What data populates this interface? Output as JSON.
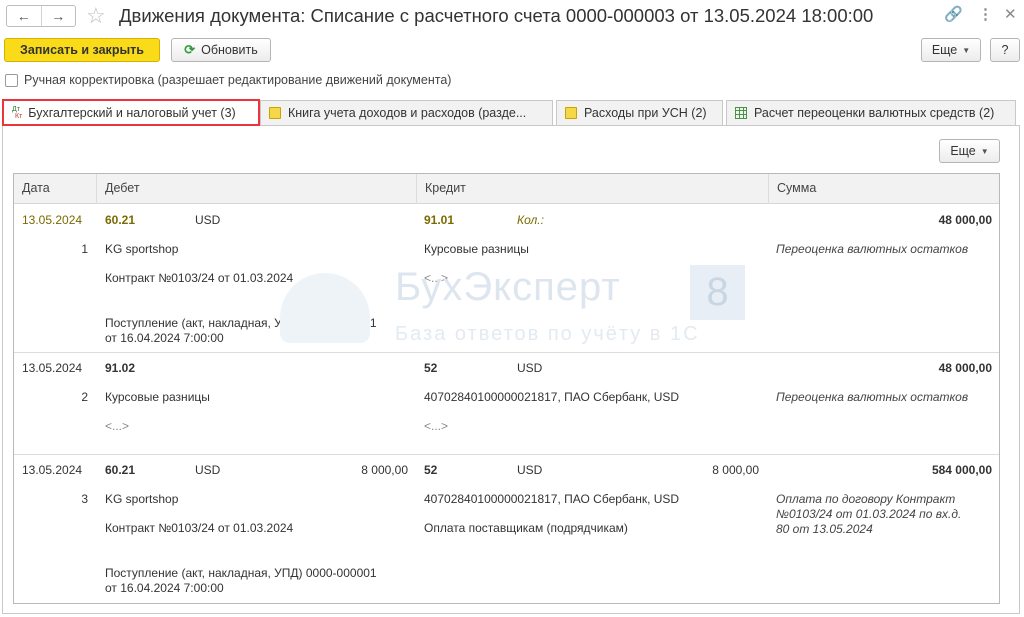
{
  "window": {
    "title": "Движения документа: Списание с расчетного счета 0000-000003 от 13.05.2024 18:00:00"
  },
  "icons": {
    "back": "arrow-left-icon",
    "forward": "arrow-right-icon",
    "star": "star-icon",
    "link": "link-icon",
    "more": "more-vertical-icon",
    "close": "close-icon",
    "refresh": "refresh-icon"
  },
  "toolbar": {
    "save_close": "Записать и закрыть",
    "refresh": "Обновить",
    "more": "Еще",
    "help": "?"
  },
  "manual_edit": {
    "label": "Ручная корректировка (разрешает редактирование движений документа)"
  },
  "tabs": [
    {
      "label": "Бухгалтерский и налоговый учет (3)"
    },
    {
      "label": "Книга учета доходов и расходов (разде..."
    },
    {
      "label": "Расходы при УСН (2)"
    },
    {
      "label": "Расчет переоценки валютных средств (2)"
    }
  ],
  "panel": {
    "more": "Еще"
  },
  "table": {
    "columns": [
      "Дата",
      "Дебет",
      "Кредит",
      "Сумма"
    ],
    "rows": [
      {
        "date": "13.05.2024",
        "num": "1",
        "debit_account": "60.21",
        "debit_currency": "USD",
        "debit_amount": "",
        "debit_line1": "KG sportshop",
        "debit_line2": "Контракт №0103/24 от 01.03.2024",
        "debit_line3": "Поступление (акт, накладная, УПД) 0000-000001",
        "debit_line4": "от 16.04.2024 7:00:00",
        "credit_account": "91.01",
        "credit_currency": "Кол.:",
        "credit_amount": "",
        "credit_line1": "Курсовые разницы",
        "credit_line2": "<...>",
        "sum": "48 000,00",
        "sum_note": "Переоценка валютных остатков"
      },
      {
        "date": "13.05.2024",
        "num": "2",
        "debit_account": "91.02",
        "debit_currency": "",
        "debit_amount": "",
        "debit_line1": "Курсовые разницы",
        "debit_line2": "<...>",
        "debit_line3": "",
        "debit_line4": "",
        "credit_account": "52",
        "credit_currency": "USD",
        "credit_amount": "",
        "credit_line1": "40702840100000021817, ПАО Сбербанк, USD",
        "credit_line2": "<...>",
        "sum": "48 000,00",
        "sum_note": "Переоценка валютных остатков"
      },
      {
        "date": "13.05.2024",
        "num": "3",
        "debit_account": "60.21",
        "debit_currency": "USD",
        "debit_amount": "8 000,00",
        "debit_line1": "KG sportshop",
        "debit_line2": "Контракт №0103/24 от 01.03.2024",
        "debit_line3": "Поступление (акт, накладная, УПД) 0000-000001",
        "debit_line4": "от 16.04.2024 7:00:00",
        "credit_account": "52",
        "credit_currency": "USD",
        "credit_amount": "8 000,00",
        "credit_line1": "40702840100000021817, ПАО Сбербанк, USD",
        "credit_line2": "Оплата поставщикам (подрядчикам)",
        "sum": "584 000,00",
        "sum_note1": "Оплата по договору Контракт",
        "sum_note2": "№0103/24 от 01.03.2024 по вх.д.",
        "sum_note3": "80 от 13.05.2024"
      }
    ]
  },
  "watermark": {
    "title": "БухЭксперт",
    "digit": "8",
    "subtitle": "База ответов по учёту в 1С"
  }
}
